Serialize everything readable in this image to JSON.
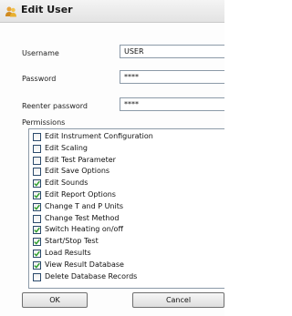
{
  "window": {
    "title": "Edit User",
    "icon": "users-icon"
  },
  "form": {
    "username_label": "Username",
    "username_value": "USER",
    "password_label": "Password",
    "password_value": "****",
    "reenter_label": "Reenter password",
    "reenter_value": "****"
  },
  "permissions": {
    "label": "Permissions",
    "items": [
      {
        "label": "Edit Instrument Configuration",
        "checked": false
      },
      {
        "label": "Edit Scaling",
        "checked": false
      },
      {
        "label": "Edit Test Parameter",
        "checked": false
      },
      {
        "label": "Edit Save Options",
        "checked": false
      },
      {
        "label": "Edit Sounds",
        "checked": true
      },
      {
        "label": "Edit Report Options",
        "checked": true
      },
      {
        "label": "Change T and P Units",
        "checked": true
      },
      {
        "label": "Change Test Method",
        "checked": false
      },
      {
        "label": "Switch Heating on/off",
        "checked": true
      },
      {
        "label": "Start/Stop Test",
        "checked": true
      },
      {
        "label": "Load Results",
        "checked": true
      },
      {
        "label": "View Result Database",
        "checked": true
      },
      {
        "label": "Delete Database Records",
        "checked": false
      }
    ]
  },
  "buttons": {
    "ok_label": "OK",
    "cancel_label": "Cancel"
  },
  "colors": {
    "check_mark": "#2e9e2e",
    "checkbox_border": "#2b4a6c"
  }
}
